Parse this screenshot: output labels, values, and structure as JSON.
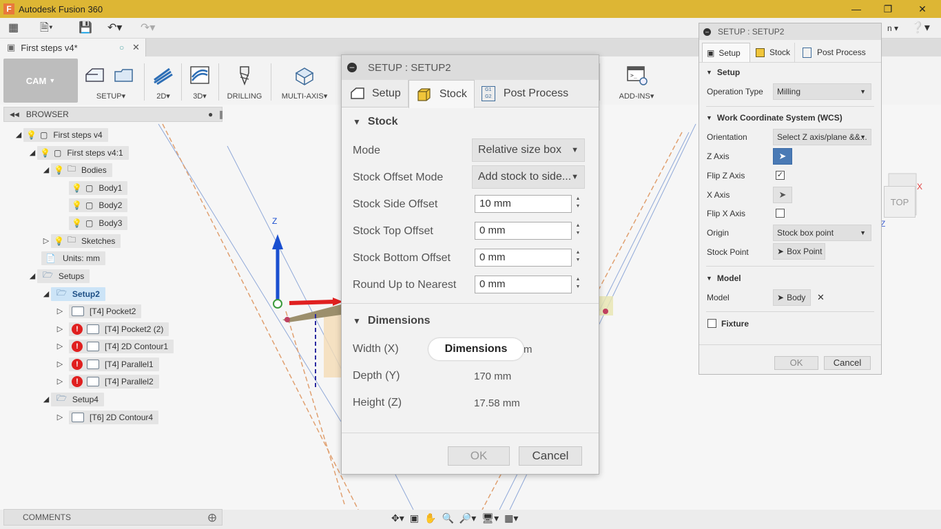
{
  "window": {
    "title": "Autodesk Fusion 360",
    "app_icon": "F"
  },
  "doc_tab": {
    "label": "First steps v4*"
  },
  "toolbar": {
    "cam": "CAM",
    "groups": [
      "SETUP",
      "2D",
      "3D",
      "DRILLING",
      "MULTI-AXIS",
      "ADD-INS"
    ]
  },
  "browser": {
    "title": "BROWSER",
    "nodes": [
      "First steps v4",
      "First steps v4:1",
      "Bodies",
      "Body1",
      "Body2",
      "Body3",
      "Sketches",
      "Units: mm",
      "Setups",
      "Setup2",
      "[T4] Pocket2",
      "[T4] Pocket2 (2)",
      "[T4] 2D Contour1",
      "[T4] Parallel1",
      "[T4] Parallel2",
      "Setup4",
      "[T6] 2D Contour4"
    ]
  },
  "comments": {
    "label": "COMMENTS"
  },
  "viewcube": {
    "top": "TOP",
    "x": "X",
    "z": "Z"
  },
  "axis_z": "Z",
  "dialog": {
    "title": "SETUP : SETUP2",
    "tabs": [
      "Setup",
      "Stock",
      "Post Process"
    ],
    "stock_section": "Stock",
    "mode_label": "Mode",
    "mode_value": "Relative size box",
    "offset_mode_label": "Stock Offset Mode",
    "offset_mode_value": "Add stock to side...",
    "side_offset_label": "Stock Side Offset",
    "side_offset_value": "10 mm",
    "top_offset_label": "Stock Top Offset",
    "top_offset_value": "0 mm",
    "bottom_offset_label": "Stock Bottom Offset",
    "bottom_offset_value": "0 mm",
    "round_up_label": "Round Up to Nearest",
    "round_up_value": "0 mm",
    "dimensions_section": "Dimensions",
    "width_label": "Width (X)",
    "width_value_tail": "m",
    "depth_label": "Depth (Y)",
    "depth_value": "170 mm",
    "height_label": "Height (Z)",
    "height_value": "17.58 mm",
    "ok": "OK",
    "cancel": "Cancel"
  },
  "tooltip": {
    "text": "Dimensions"
  },
  "right_panel": {
    "title": "SETUP : SETUP2",
    "tabs": [
      "Setup",
      "Stock",
      "Post Process"
    ],
    "setup_section": "Setup",
    "operation_type_label": "Operation Type",
    "operation_type_value": "Milling",
    "wcs_section": "Work Coordinate System (WCS)",
    "orientation_label": "Orientation",
    "orientation_value": "Select Z axis/plane &&...",
    "z_axis_label": "Z Axis",
    "flip_z_label": "Flip Z Axis",
    "flip_z_checked": true,
    "x_axis_label": "X Axis",
    "flip_x_label": "Flip X Axis",
    "flip_x_checked": false,
    "origin_label": "Origin",
    "origin_value": "Stock box point",
    "stock_point_label": "Stock Point",
    "stock_point_value": "Box Point",
    "model_section": "Model",
    "model_label": "Model",
    "model_value": "Body",
    "fixture_label": "Fixture",
    "ok": "OK",
    "cancel": "Cancel"
  },
  "colors": {
    "titlebar": "#ddb634",
    "active_blue": "#4a7ab5",
    "error_red": "#e02020"
  }
}
